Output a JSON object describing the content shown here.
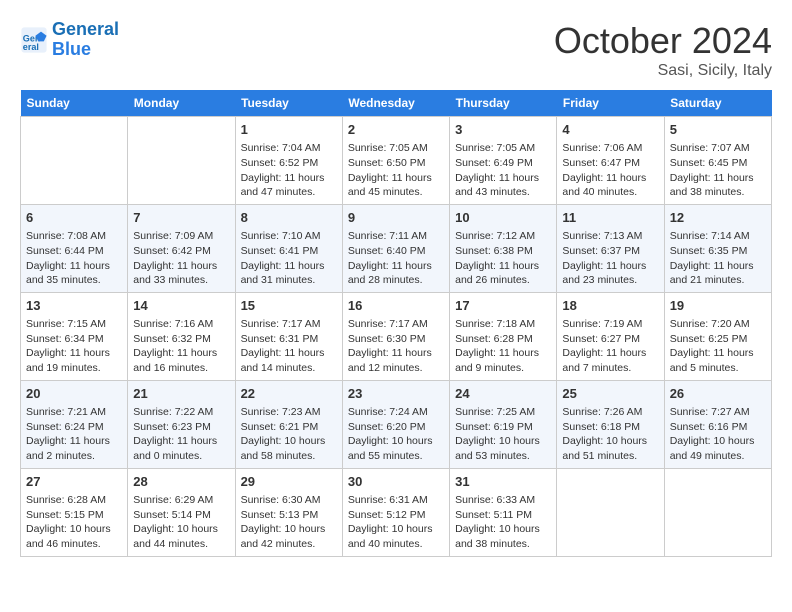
{
  "header": {
    "logo_line1": "General",
    "logo_line2": "Blue",
    "month": "October 2024",
    "location": "Sasi, Sicily, Italy"
  },
  "days_of_week": [
    "Sunday",
    "Monday",
    "Tuesday",
    "Wednesday",
    "Thursday",
    "Friday",
    "Saturday"
  ],
  "weeks": [
    [
      {
        "day": "",
        "info": ""
      },
      {
        "day": "",
        "info": ""
      },
      {
        "day": "1",
        "info": "Sunrise: 7:04 AM\nSunset: 6:52 PM\nDaylight: 11 hours and 47 minutes."
      },
      {
        "day": "2",
        "info": "Sunrise: 7:05 AM\nSunset: 6:50 PM\nDaylight: 11 hours and 45 minutes."
      },
      {
        "day": "3",
        "info": "Sunrise: 7:05 AM\nSunset: 6:49 PM\nDaylight: 11 hours and 43 minutes."
      },
      {
        "day": "4",
        "info": "Sunrise: 7:06 AM\nSunset: 6:47 PM\nDaylight: 11 hours and 40 minutes."
      },
      {
        "day": "5",
        "info": "Sunrise: 7:07 AM\nSunset: 6:45 PM\nDaylight: 11 hours and 38 minutes."
      }
    ],
    [
      {
        "day": "6",
        "info": "Sunrise: 7:08 AM\nSunset: 6:44 PM\nDaylight: 11 hours and 35 minutes."
      },
      {
        "day": "7",
        "info": "Sunrise: 7:09 AM\nSunset: 6:42 PM\nDaylight: 11 hours and 33 minutes."
      },
      {
        "day": "8",
        "info": "Sunrise: 7:10 AM\nSunset: 6:41 PM\nDaylight: 11 hours and 31 minutes."
      },
      {
        "day": "9",
        "info": "Sunrise: 7:11 AM\nSunset: 6:40 PM\nDaylight: 11 hours and 28 minutes."
      },
      {
        "day": "10",
        "info": "Sunrise: 7:12 AM\nSunset: 6:38 PM\nDaylight: 11 hours and 26 minutes."
      },
      {
        "day": "11",
        "info": "Sunrise: 7:13 AM\nSunset: 6:37 PM\nDaylight: 11 hours and 23 minutes."
      },
      {
        "day": "12",
        "info": "Sunrise: 7:14 AM\nSunset: 6:35 PM\nDaylight: 11 hours and 21 minutes."
      }
    ],
    [
      {
        "day": "13",
        "info": "Sunrise: 7:15 AM\nSunset: 6:34 PM\nDaylight: 11 hours and 19 minutes."
      },
      {
        "day": "14",
        "info": "Sunrise: 7:16 AM\nSunset: 6:32 PM\nDaylight: 11 hours and 16 minutes."
      },
      {
        "day": "15",
        "info": "Sunrise: 7:17 AM\nSunset: 6:31 PM\nDaylight: 11 hours and 14 minutes."
      },
      {
        "day": "16",
        "info": "Sunrise: 7:17 AM\nSunset: 6:30 PM\nDaylight: 11 hours and 12 minutes."
      },
      {
        "day": "17",
        "info": "Sunrise: 7:18 AM\nSunset: 6:28 PM\nDaylight: 11 hours and 9 minutes."
      },
      {
        "day": "18",
        "info": "Sunrise: 7:19 AM\nSunset: 6:27 PM\nDaylight: 11 hours and 7 minutes."
      },
      {
        "day": "19",
        "info": "Sunrise: 7:20 AM\nSunset: 6:25 PM\nDaylight: 11 hours and 5 minutes."
      }
    ],
    [
      {
        "day": "20",
        "info": "Sunrise: 7:21 AM\nSunset: 6:24 PM\nDaylight: 11 hours and 2 minutes."
      },
      {
        "day": "21",
        "info": "Sunrise: 7:22 AM\nSunset: 6:23 PM\nDaylight: 11 hours and 0 minutes."
      },
      {
        "day": "22",
        "info": "Sunrise: 7:23 AM\nSunset: 6:21 PM\nDaylight: 10 hours and 58 minutes."
      },
      {
        "day": "23",
        "info": "Sunrise: 7:24 AM\nSunset: 6:20 PM\nDaylight: 10 hours and 55 minutes."
      },
      {
        "day": "24",
        "info": "Sunrise: 7:25 AM\nSunset: 6:19 PM\nDaylight: 10 hours and 53 minutes."
      },
      {
        "day": "25",
        "info": "Sunrise: 7:26 AM\nSunset: 6:18 PM\nDaylight: 10 hours and 51 minutes."
      },
      {
        "day": "26",
        "info": "Sunrise: 7:27 AM\nSunset: 6:16 PM\nDaylight: 10 hours and 49 minutes."
      }
    ],
    [
      {
        "day": "27",
        "info": "Sunrise: 6:28 AM\nSunset: 5:15 PM\nDaylight: 10 hours and 46 minutes."
      },
      {
        "day": "28",
        "info": "Sunrise: 6:29 AM\nSunset: 5:14 PM\nDaylight: 10 hours and 44 minutes."
      },
      {
        "day": "29",
        "info": "Sunrise: 6:30 AM\nSunset: 5:13 PM\nDaylight: 10 hours and 42 minutes."
      },
      {
        "day": "30",
        "info": "Sunrise: 6:31 AM\nSunset: 5:12 PM\nDaylight: 10 hours and 40 minutes."
      },
      {
        "day": "31",
        "info": "Sunrise: 6:33 AM\nSunset: 5:11 PM\nDaylight: 10 hours and 38 minutes."
      },
      {
        "day": "",
        "info": ""
      },
      {
        "day": "",
        "info": ""
      }
    ]
  ]
}
